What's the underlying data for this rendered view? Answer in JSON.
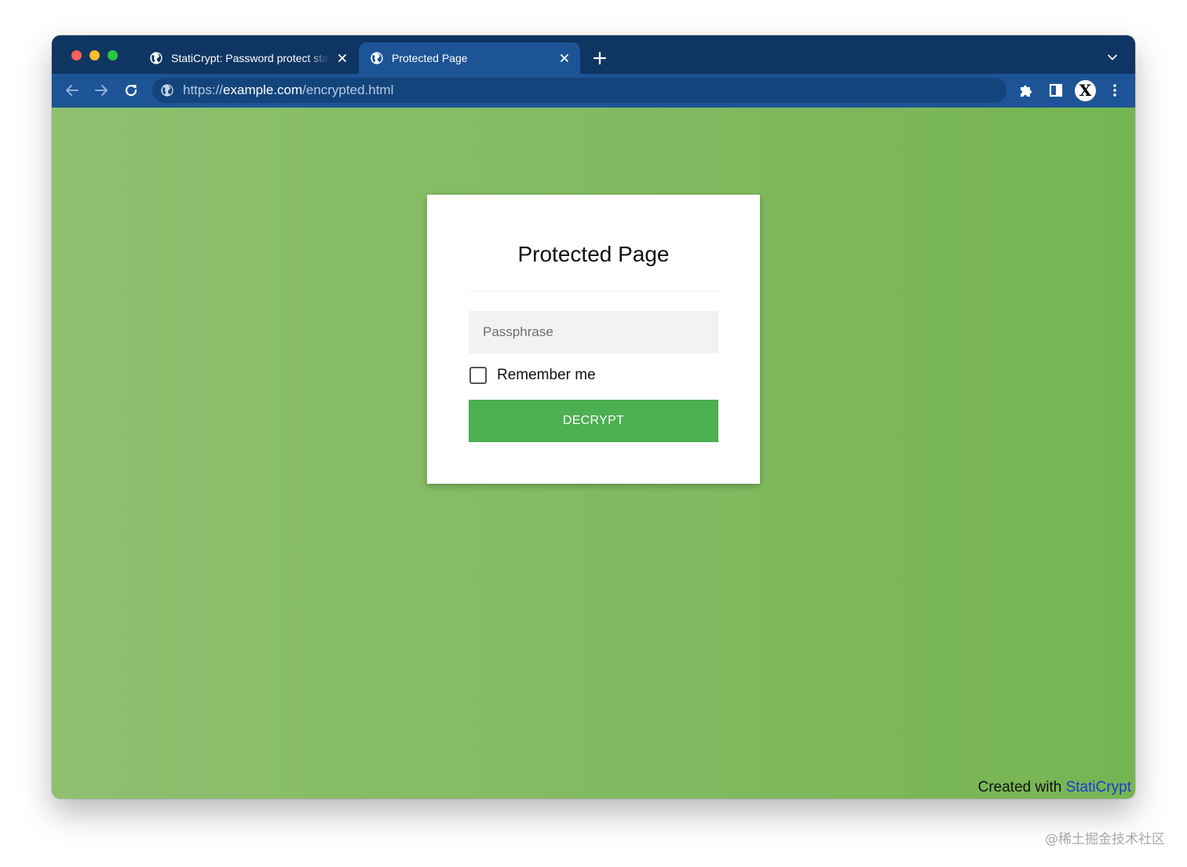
{
  "browser": {
    "tabs": [
      {
        "title": "StatiCrypt: Password protect static HTML",
        "active": false
      },
      {
        "title": "Protected Page",
        "active": true
      }
    ],
    "address_bar": {
      "scheme": "https://",
      "host": "example.com",
      "path": "/encrypted.html"
    },
    "profile_initial": "X"
  },
  "page": {
    "title": "Protected Page",
    "passphrase_placeholder": "Passphrase",
    "remember_label": "Remember me",
    "remember_checked": false,
    "decrypt_label": "DECRYPT",
    "footer_prefix": "Created with ",
    "footer_link": "StatiCrypt"
  },
  "watermark": "@稀土掘金技术社区",
  "colors": {
    "tabstrip": "#0f3562",
    "toolbar": "#1d5496",
    "page_bg": "#80b95f",
    "button": "#4caf50",
    "link": "#1a3bd6"
  },
  "icons": [
    "globe-icon",
    "close-icon",
    "plus-icon",
    "chevron-down-icon",
    "back-arrow-icon",
    "forward-arrow-icon",
    "reload-icon",
    "puzzle-icon",
    "sidebar-icon",
    "kebab-menu-icon"
  ]
}
